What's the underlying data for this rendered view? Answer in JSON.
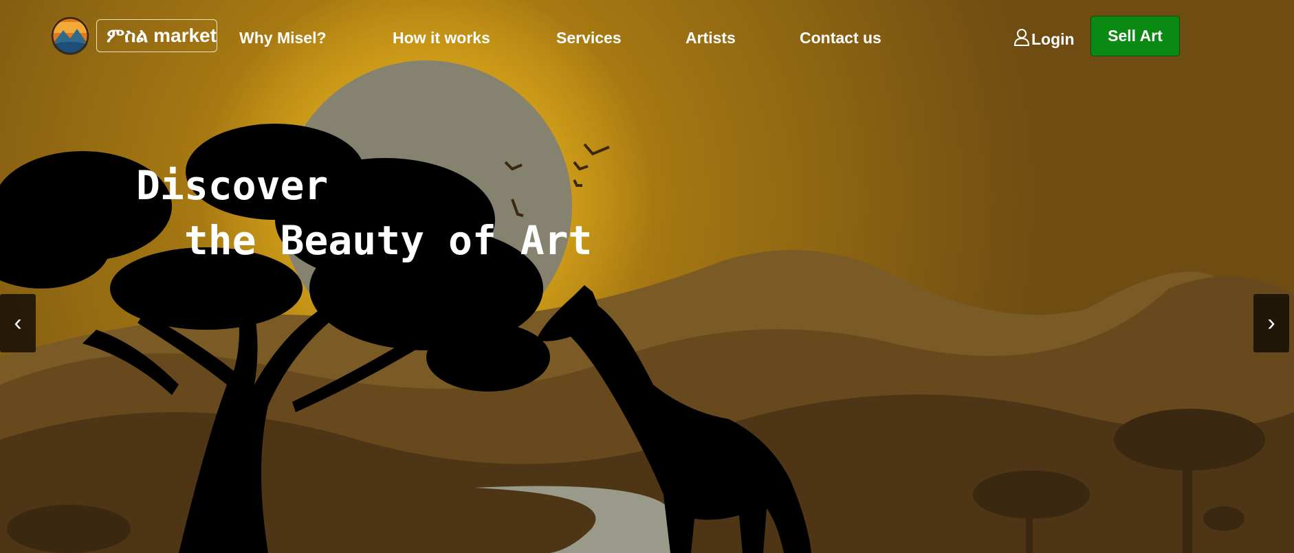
{
  "nav": {
    "brand_label": "ምስል market",
    "links": [
      "Why Misel?",
      "How it works",
      "Services",
      "Artists",
      "Contact us"
    ],
    "login_label": "Login",
    "sell_label": "Sell Art"
  },
  "hero": {
    "line1": "Discover",
    "line2": "  the Beauty of Art"
  },
  "carousel": {
    "prev_label": "‹",
    "next_label": "›"
  },
  "icons": {
    "login": "user-icon",
    "logo": "logo-icon"
  },
  "colors": {
    "sell_button": "#0a8a12",
    "sky_top": "#7a5710",
    "sky_glow": "#b8870f"
  }
}
